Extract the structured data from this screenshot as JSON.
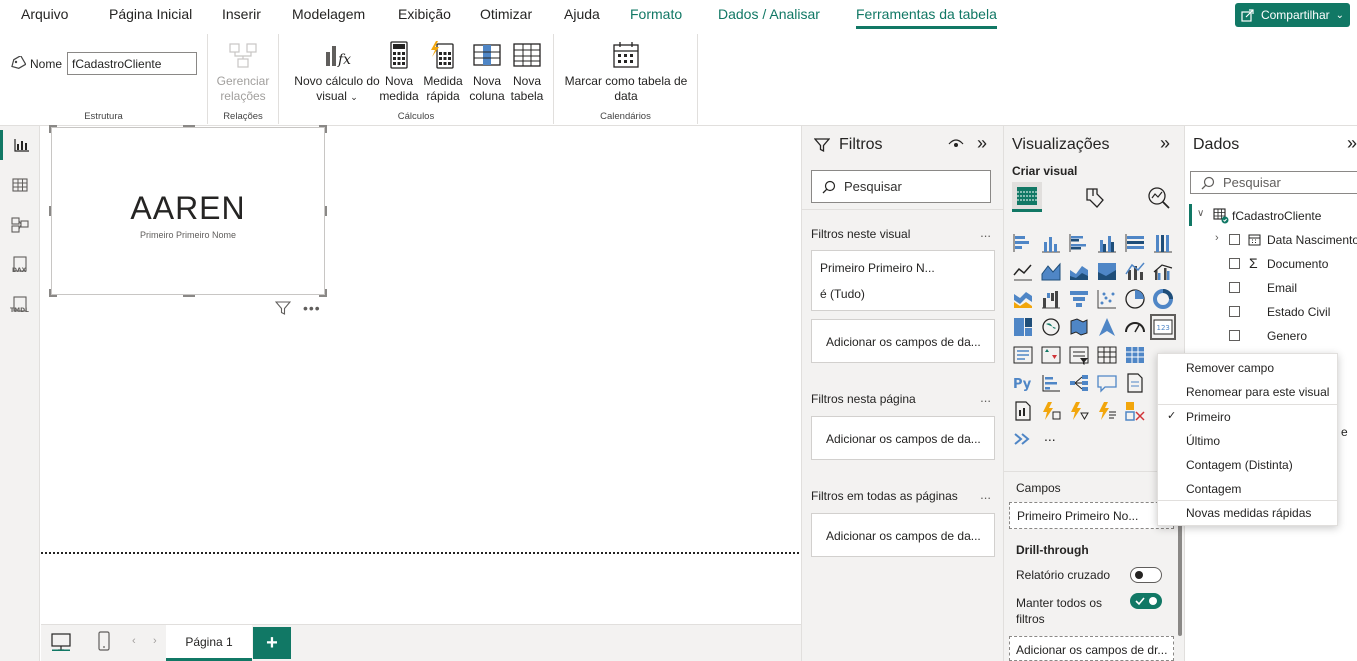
{
  "tabs": [
    {
      "label": "Arquivo"
    },
    {
      "label": "Página Inicial"
    },
    {
      "label": "Inserir"
    },
    {
      "label": "Modelagem"
    },
    {
      "label": "Exibição"
    },
    {
      "label": "Otimizar"
    },
    {
      "label": "Ajuda"
    },
    {
      "label": "Formato"
    },
    {
      "label": "Dados / Analisar"
    },
    {
      "label": "Ferramentas da tabela"
    }
  ],
  "share_label": "Compartilhar",
  "ribbon": {
    "name_label": "Nome",
    "name_value": "fCadastroCliente",
    "groups": {
      "estrutura": "Estrutura",
      "relacoes": "Relações",
      "calculos": "Cálculos",
      "calendarios": "Calendários"
    },
    "buttons": {
      "gerenciar_1": "Gerenciar",
      "gerenciar_2": "relações",
      "novo_calc_1": "Novo cálculo do",
      "novo_calc_2": "visual",
      "nova_medida_1": "Nova",
      "nova_medida_2": "medida",
      "medida_rapida_1": "Medida",
      "medida_rapida_2": "rápida",
      "nova_coluna_1": "Nova",
      "nova_coluna_2": "coluna",
      "nova_tabela_1": "Nova",
      "nova_tabela_2": "tabela",
      "marcar_1": "Marcar como tabela de",
      "marcar_2": "data"
    }
  },
  "card": {
    "value": "AAREN",
    "label": "Primeiro Primeiro Nome"
  },
  "bottom": {
    "page_tab": "Página 1",
    "add_page": "+"
  },
  "filters": {
    "title": "Filtros",
    "search_placeholder": "Pesquisar",
    "sec_visual": "Filtros neste visual",
    "filter_field": "Primeiro Primeiro N...",
    "filter_state": "é (Tudo)",
    "add_fields": "Adicionar os campos de da...",
    "sec_page": "Filtros nesta página",
    "sec_all": "Filtros em todas as páginas",
    "more": "..."
  },
  "viz": {
    "title": "Visualizações",
    "subtitle": "Criar visual",
    "campos_label": "Campos",
    "campos_field": "Primeiro Primeiro No...",
    "drill_title": "Drill-through",
    "relatorio_cruzado": "Relatório cruzado",
    "relatorio_state": "off",
    "manter_1": "Manter todos os",
    "manter_2": "filtros",
    "manter_state": "on",
    "add_drill": "Adicionar os campos de dr...",
    "more_visuals": "..."
  },
  "data_pane": {
    "title": "Dados",
    "search_placeholder": "Pesquisar",
    "table": "fCadastroCliente",
    "fields": [
      "Data Nascimento",
      "Documento",
      "Email",
      "Estado Civil",
      "Genero"
    ],
    "sigma": "Σ",
    "hidden_char": "e"
  },
  "context_menu": {
    "items": [
      "Remover campo",
      "Renomear para este visual",
      "Primeiro",
      "Último",
      "Contagem (Distinta)",
      "Contagem",
      "Novas medidas rápidas"
    ],
    "checked": "Primeiro",
    "check_mark": "✓"
  },
  "colors": {
    "accent": "#117865",
    "pane_bg": "#f3f2f1",
    "border": "#e1dfdd"
  }
}
